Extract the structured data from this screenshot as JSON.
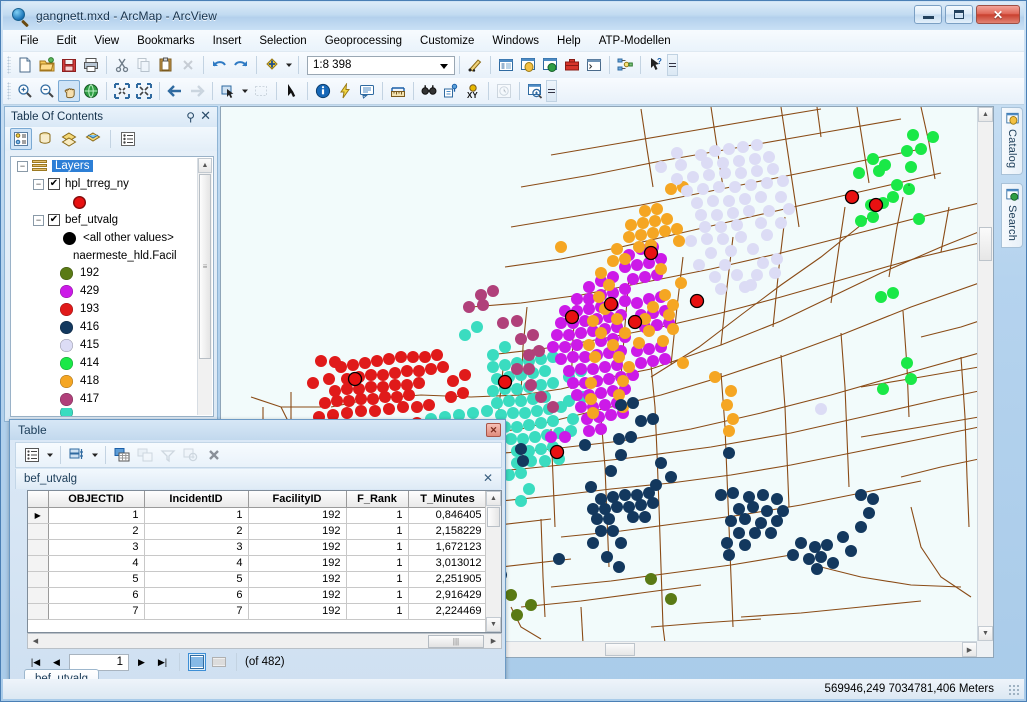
{
  "window": {
    "title": "gangnett.mxd - ArcMap - ArcView",
    "app_icon": "magnifier-globe-icon",
    "buttons": {
      "minimize": "minimize-button",
      "maximize": "maximize-button",
      "close": "close-button",
      "close_glyph": "✕"
    }
  },
  "menu": {
    "items": [
      {
        "label": "File",
        "accel": "F"
      },
      {
        "label": "Edit",
        "accel": "E"
      },
      {
        "label": "View",
        "accel": "V"
      },
      {
        "label": "Bookmarks",
        "accel": "B"
      },
      {
        "label": "Insert",
        "accel": "I"
      },
      {
        "label": "Selection",
        "accel": "S"
      },
      {
        "label": "Geoprocessing",
        "accel": "G"
      },
      {
        "label": "Customize",
        "accel": "C"
      },
      {
        "label": "Windows",
        "accel": "W"
      },
      {
        "label": "Help",
        "accel": "H"
      },
      {
        "label": "ATP-Modellen",
        "accel": ""
      }
    ]
  },
  "toolbar_standard": {
    "scale_value": "1:8 398",
    "buttons": [
      "new-document-icon",
      "open-folder-icon",
      "save-icon",
      "print-icon",
      "cut-icon",
      "copy-icon",
      "paste-icon",
      "delete-icon",
      "undo-icon",
      "redo-icon",
      "add-data-icon",
      "editor-toolbar-icon",
      "table-of-contents-icon",
      "catalog-icon",
      "search-icon",
      "arctoolbox-icon",
      "python-window-icon",
      "model-builder-icon",
      "help-pointer-icon"
    ]
  },
  "toolbar_tools": {
    "buttons": [
      "zoom-in-icon",
      "zoom-out-icon",
      "pan-icon",
      "full-extent-icon",
      "fixed-zoom-in-icon",
      "fixed-zoom-out-icon",
      "go-back-extent-icon",
      "go-forward-extent-icon",
      "select-features-icon",
      "clear-selection-icon",
      "select-elements-icon",
      "identify-icon",
      "hyperlink-icon",
      "html-popup-icon",
      "measure-icon",
      "find-icon",
      "find-route-icon",
      "go-to-xy-icon",
      "time-slider-icon",
      "create-viewer-window-icon"
    ],
    "active": "pan-icon"
  },
  "toc": {
    "title": "Table Of Contents",
    "pin_icon": "pin-icon",
    "close_icon": "close-icon",
    "toolbar_buttons": [
      "list-by-drawing-order-icon",
      "list-by-source-icon",
      "list-by-visibility-icon",
      "list-by-selection-icon",
      "options-icon"
    ],
    "active_toolbar_button": "list-by-drawing-order-icon",
    "root": {
      "label": "Layers",
      "selected": true,
      "expander": "−"
    },
    "layers": [
      {
        "name": "hpl_trreg_ny",
        "checked": true,
        "expander": "−",
        "symbols": [
          {
            "label": "",
            "color": "#e81111"
          }
        ]
      },
      {
        "name": "bef_utvalg",
        "checked": true,
        "expander": "−",
        "field": "naermeste_hld.Facil",
        "symbols": [
          {
            "label": "<all other values>",
            "color": "#000000"
          },
          {
            "label": "192",
            "color": "#5a7a15"
          },
          {
            "label": "429",
            "color": "#cc1ae8"
          },
          {
            "label": "193",
            "color": "#e01a1a"
          },
          {
            "label": "416",
            "color": "#13385e"
          },
          {
            "label": "415",
            "color": "#dcdcf5"
          },
          {
            "label": "414",
            "color": "#1ae847"
          },
          {
            "label": "418",
            "color": "#f5a623"
          },
          {
            "label": "417",
            "color": "#b0407a"
          },
          {
            "label": "",
            "color": "#3adcc0"
          }
        ]
      }
    ]
  },
  "right_tabs": [
    {
      "label": "Catalog",
      "icon": "catalog-icon"
    },
    {
      "label": "Search",
      "icon": "search-window-icon"
    }
  ],
  "table_window": {
    "title": "Table",
    "close_glyph": "✕",
    "toolbar_buttons": [
      "table-options-icon",
      "related-tables-icon",
      "select-by-attributes-icon",
      "switch-selection-icon",
      "clear-selection-icon",
      "zoom-to-selected-icon",
      "delete-selected-icon"
    ],
    "tab_label": "bef_utvalg",
    "tab_close_glyph": "✕",
    "columns": [
      "",
      "OBJECTID",
      "IncidentID",
      "FacilityID",
      "F_Rank",
      "T_Minutes"
    ],
    "column_display": [
      "",
      "OBJECTID",
      "IncidentID",
      "FacilityID",
      "F_Rank",
      "T_Minutes"
    ],
    "rows": [
      {
        "marker": "▶",
        "OBJECTID": "1",
        "IncidentID": "1",
        "FacilityID": "192",
        "F_Rank": "1",
        "T_Minutes": "0,846405"
      },
      {
        "marker": "",
        "OBJECTID": "2",
        "IncidentID": "2",
        "FacilityID": "192",
        "F_Rank": "1",
        "T_Minutes": "2,158229"
      },
      {
        "marker": "",
        "OBJECTID": "3",
        "IncidentID": "3",
        "FacilityID": "192",
        "F_Rank": "1",
        "T_Minutes": "1,672123"
      },
      {
        "marker": "",
        "OBJECTID": "4",
        "IncidentID": "4",
        "FacilityID": "192",
        "F_Rank": "1",
        "T_Minutes": "3,013012"
      },
      {
        "marker": "",
        "OBJECTID": "5",
        "IncidentID": "5",
        "FacilityID": "192",
        "F_Rank": "1",
        "T_Minutes": "2,251905"
      },
      {
        "marker": "",
        "OBJECTID": "6",
        "IncidentID": "6",
        "FacilityID": "192",
        "F_Rank": "1",
        "T_Minutes": "2,916429"
      },
      {
        "marker": "",
        "OBJECTID": "7",
        "IncidentID": "7",
        "FacilityID": "192",
        "F_Rank": "1",
        "T_Minutes": "2,224469"
      }
    ],
    "nav": {
      "first_glyph": "|◀",
      "prev_glyph": "◀",
      "record": "1",
      "next_glyph": "▶",
      "last_glyph": "▶|",
      "show_all_icon": "show-all-records-icon",
      "show_selected_icon": "show-selected-records-icon",
      "count_text": "(of 482)"
    },
    "bottom_tab": "bef_utvalg"
  },
  "statusbar": {
    "coordinates": "569946,249  7034781,406 Meters"
  },
  "map": {
    "background": "#f2fbfb",
    "road_color": "#8a4b16",
    "symbol_colors": {
      "facility_192": "#5a7a15",
      "facility_429": "#cc1ae8",
      "facility_193": "#e01a1a",
      "facility_416": "#13385e",
      "facility_415": "#dcdcf5",
      "facility_414": "#1ae847",
      "facility_418": "#f5a623",
      "facility_417": "#b0407a",
      "facility_teal": "#3adcc0",
      "stops": "#e81111"
    }
  }
}
